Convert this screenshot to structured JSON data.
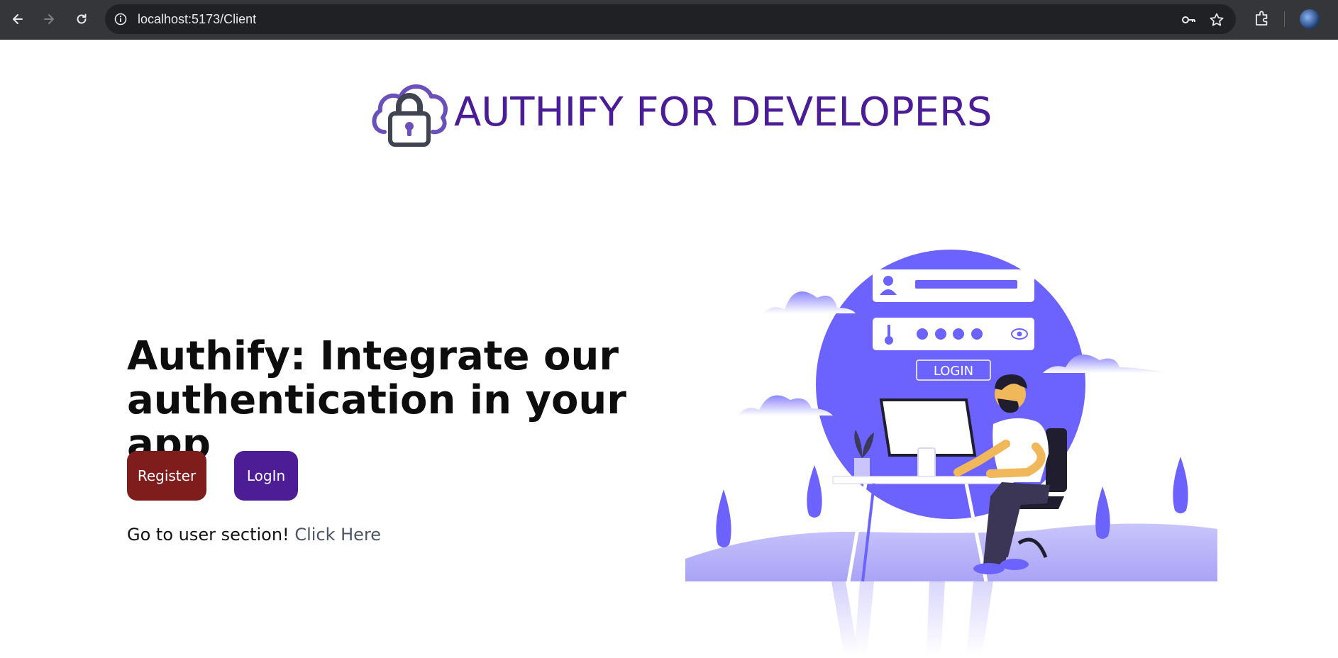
{
  "browser": {
    "url": "localhost:5173/Client",
    "icons": [
      "back-arrow-icon",
      "forward-arrow-icon",
      "reload-icon",
      "site-info-icon",
      "password-key-icon",
      "bookmark-star-icon",
      "extensions-puzzle-icon",
      "profile-avatar"
    ]
  },
  "header": {
    "brand_title": "AUTHIFY FOR DEVELOPERS"
  },
  "hero": {
    "title_line1": "Authify: Integrate our",
    "title_line2": "authentication in your app",
    "register_label": "Register",
    "login_label": "LogIn",
    "user_prompt": "Go to user section!",
    "user_link": "Click Here"
  },
  "illustration": {
    "login_label": "LOGIN"
  },
  "colors": {
    "brand": "#4a1d96",
    "register": "#7f1d1d",
    "login": "#4c1d95",
    "illustration_purple": "#6c63ff"
  }
}
